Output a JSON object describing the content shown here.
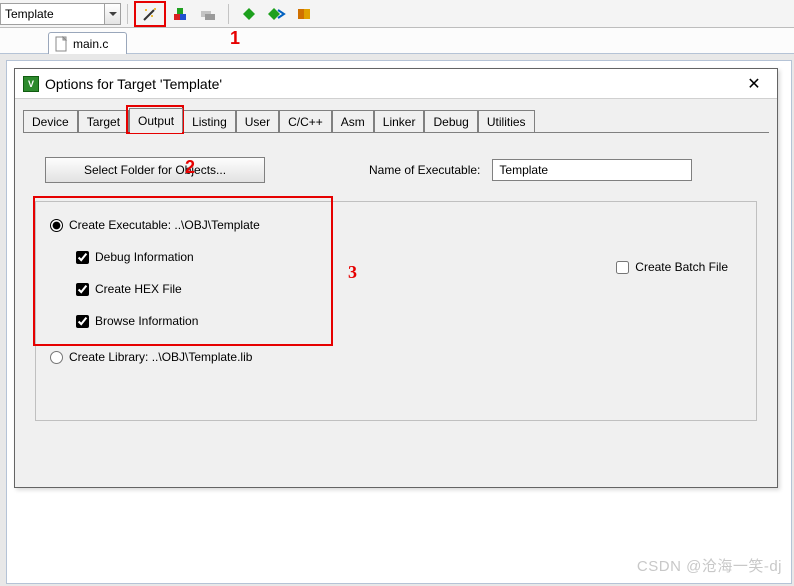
{
  "toolbar": {
    "target_combo": "Template",
    "annot1": "1"
  },
  "filetab": {
    "name": "main.c"
  },
  "dialog": {
    "title": "Options for Target 'Template'",
    "tabs": [
      "Device",
      "Target",
      "Output",
      "Listing",
      "User",
      "C/C++",
      "Asm",
      "Linker",
      "Debug",
      "Utilities"
    ],
    "active_tab": "Output",
    "annot2": "2",
    "select_folder_btn": "Select Folder for Objects...",
    "name_exec_label": "Name of Executable:",
    "name_exec_value": "Template",
    "radio_create_exec": "Create Executable:  ..\\OBJ\\Template",
    "chk_debug": "Debug Information",
    "chk_hex": "Create HEX File",
    "chk_browse": "Browse Information",
    "radio_create_lib": "Create Library:  ..\\OBJ\\Template.lib",
    "chk_batch": "Create Batch File",
    "annot3": "3"
  },
  "watermark": "CSDN @沧海一笑-dj"
}
